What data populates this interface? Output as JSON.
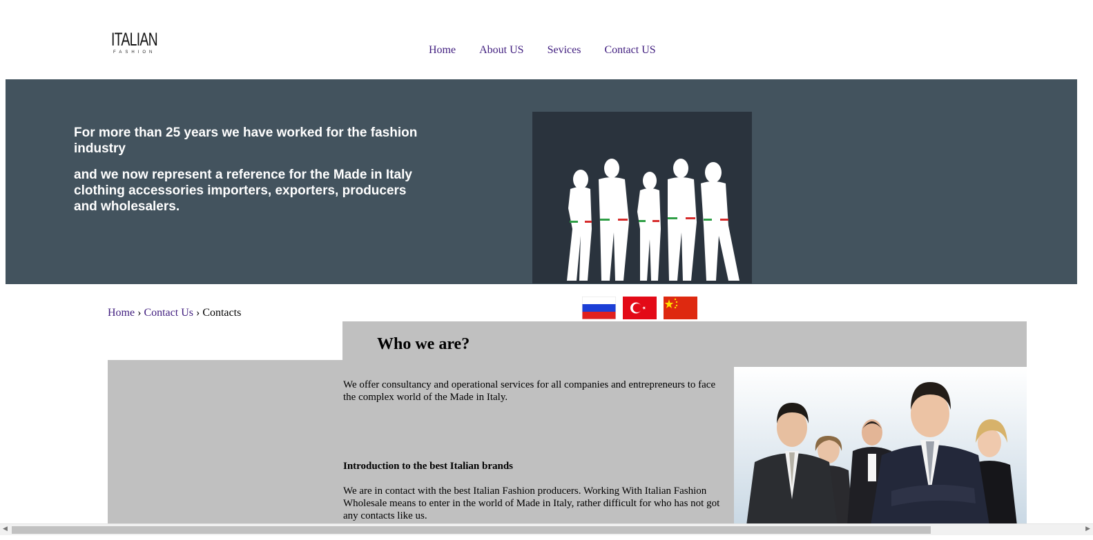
{
  "logo": {
    "text": "ITALIAN",
    "subtext": "FASHION"
  },
  "nav": {
    "items": [
      "Home",
      "About US",
      "Sevices",
      "Contact US"
    ]
  },
  "hero": {
    "line1": "For more than 25 years we have worked for the fashion industry",
    "line2": "and we now represent a reference for the Made in Italy clothing accessories importers, exporters, producers and wholesalers."
  },
  "breadcrumb": {
    "home": "Home",
    "sep1": "›",
    "contact": "Contact Us",
    "sep2": "›",
    "current": "Contacts"
  },
  "flags": [
    "russia-flag",
    "turkey-flag",
    "china-flag"
  ],
  "content": {
    "title": "Who we are?",
    "intro": "We offer consultancy and operational services for all companies and entrepreneurs to face the complex world of the Made in Italy.",
    "heading2": "Introduction to the best Italian brands",
    "para2": "We are in contact with the best Italian Fashion producers. Working With Italian Fashion Wholesale means to enter in the world of Made in Italy, rather difficult for who has not got any contacts like us."
  },
  "colors": {
    "hero_bg": "#43535e",
    "content_bg": "#c0c0c0",
    "link": "#3f1c7e"
  }
}
